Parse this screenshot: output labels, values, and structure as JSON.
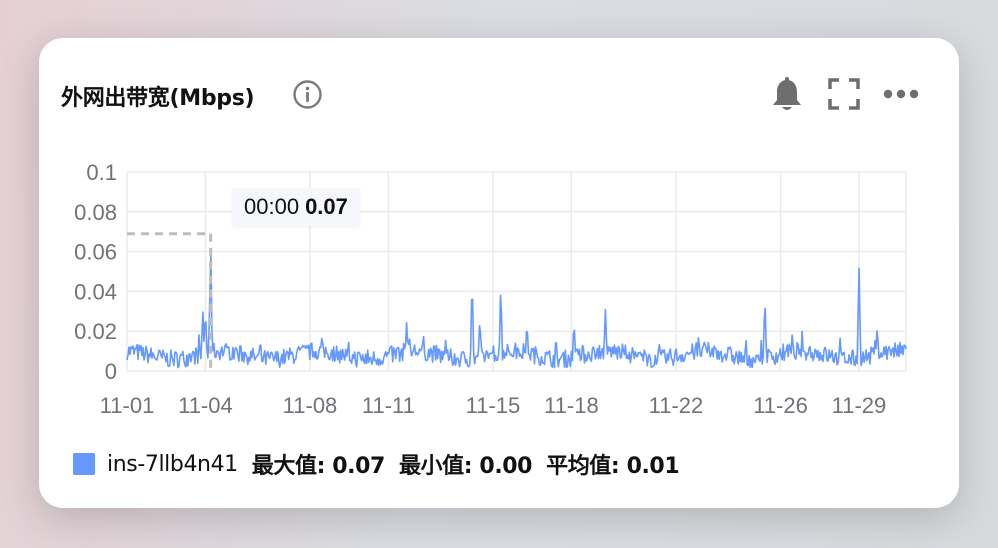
{
  "widget": {
    "title": "外网出带宽(Mbps)",
    "icons": [
      "info-icon",
      "bell-icon",
      "fullscreen-icon",
      "more-icon"
    ]
  },
  "tooltip": {
    "time": "00:00",
    "value": "0.07"
  },
  "legend": {
    "series_name": "ins-7llb4n41",
    "max_label": "最大值:",
    "max_value": "0.07",
    "min_label": "最小值:",
    "min_value": "0.00",
    "avg_label": "平均值:",
    "avg_value": "0.01"
  },
  "colors": {
    "series": "#6699ff",
    "grid": "#ebebeb",
    "axis_text": "#6f7378"
  },
  "chart_data": {
    "type": "line",
    "title": "外网出带宽(Mbps)",
    "xlabel": "",
    "ylabel": "",
    "ylim": [
      0,
      0.1
    ],
    "yticks": [
      "0",
      "0.02",
      "0.04",
      "0.06",
      "0.08",
      "0.1"
    ],
    "xticks": [
      "11-01",
      "11-04",
      "11-08",
      "11-11",
      "11-15",
      "11-18",
      "11-22",
      "11-26",
      "11-29"
    ],
    "x_range_days": [
      1,
      30.8
    ],
    "grid": true,
    "legend": "bottom-left",
    "series": [
      {
        "name": "ins-7llb4n41",
        "baseline": 0.008,
        "noise_amplitude": 0.005,
        "spikes": [
          {
            "day": 3.9,
            "value": 0.031
          },
          {
            "day": 4.0,
            "value": 0.032
          },
          {
            "day": 4.2,
            "value": 0.068
          },
          {
            "day": 11.7,
            "value": 0.025
          },
          {
            "day": 14.2,
            "value": 0.049
          },
          {
            "day": 14.5,
            "value": 0.027
          },
          {
            "day": 15.3,
            "value": 0.045
          },
          {
            "day": 16.3,
            "value": 0.025
          },
          {
            "day": 18.1,
            "value": 0.025
          },
          {
            "day": 19.3,
            "value": 0.031
          },
          {
            "day": 25.4,
            "value": 0.038
          },
          {
            "day": 29.0,
            "value": 0.055
          },
          {
            "day": 29.7,
            "value": 0.022
          }
        ],
        "max": 0.07,
        "min": 0.0,
        "avg": 0.01
      }
    ],
    "hover": {
      "time": "00:00",
      "day": 4.2,
      "value": 0.07
    }
  }
}
